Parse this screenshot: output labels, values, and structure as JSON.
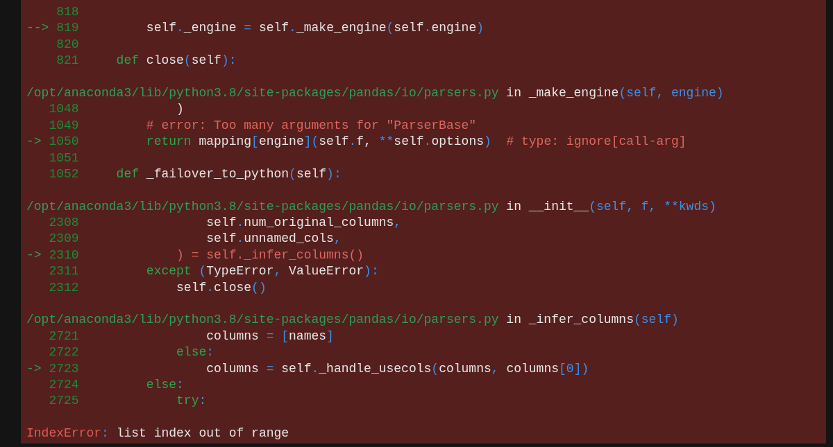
{
  "frames": [
    {
      "lines": [
        {
          "number": "818"
        },
        {
          "number": "819",
          "marker": "-->",
          "tokens": [
            {
              "kind": "text",
              "text": "         self"
            },
            {
              "kind": "punct",
              "text": "."
            },
            {
              "kind": "text",
              "text": "_engine "
            },
            {
              "kind": "punct",
              "text": "="
            },
            {
              "kind": "text",
              "text": " self"
            },
            {
              "kind": "punct",
              "text": "."
            },
            {
              "kind": "text",
              "text": "_make_engine"
            },
            {
              "kind": "punct",
              "text": "("
            },
            {
              "kind": "text",
              "text": "self"
            },
            {
              "kind": "punct",
              "text": "."
            },
            {
              "kind": "text",
              "text": "engine"
            },
            {
              "kind": "punct",
              "text": ")"
            }
          ]
        },
        {
          "number": "820"
        },
        {
          "number": "821",
          "tokens": [
            {
              "kind": "keyword",
              "text": "     def"
            },
            {
              "kind": "text",
              "text": " close"
            },
            {
              "kind": "punct",
              "text": "("
            },
            {
              "kind": "text",
              "text": "self"
            },
            {
              "kind": "punct",
              "text": "):"
            }
          ]
        }
      ]
    },
    {
      "header": {
        "path": "/opt/anaconda3/lib/python3.8/site-packages/pandas/io/parsers.py",
        "word": "in",
        "function": "_make_engine",
        "args": "(self, engine)"
      },
      "lines": [
        {
          "number": "1048",
          "tokens": [
            {
              "kind": "text",
              "text": "             )"
            }
          ]
        },
        {
          "number": "1049",
          "tokens": [
            {
              "kind": "comment",
              "text": "         # error: Too many arguments for \"ParserBase\""
            }
          ]
        },
        {
          "number": "1050",
          "marker": "->",
          "tokens": [
            {
              "kind": "keyword",
              "text": "         return"
            },
            {
              "kind": "text",
              "text": " mapping"
            },
            {
              "kind": "punct",
              "text": "["
            },
            {
              "kind": "text",
              "text": "engine"
            },
            {
              "kind": "punct",
              "text": "]("
            },
            {
              "kind": "text",
              "text": "self"
            },
            {
              "kind": "punct",
              "text": "."
            },
            {
              "kind": "text",
              "text": "f, "
            },
            {
              "kind": "punct",
              "text": "**"
            },
            {
              "kind": "text",
              "text": "self"
            },
            {
              "kind": "punct",
              "text": "."
            },
            {
              "kind": "text",
              "text": "options"
            },
            {
              "kind": "punct",
              "text": ")"
            },
            {
              "kind": "comment",
              "text": "  # type: ignore[call-arg]"
            }
          ]
        },
        {
          "number": "1051"
        },
        {
          "number": "1052",
          "tokens": [
            {
              "kind": "keyword",
              "text": "     def"
            },
            {
              "kind": "text",
              "text": " _failover_to_python"
            },
            {
              "kind": "punct",
              "text": "("
            },
            {
              "kind": "text",
              "text": "self"
            },
            {
              "kind": "punct",
              "text": "):"
            }
          ]
        }
      ]
    },
    {
      "header": {
        "path": "/opt/anaconda3/lib/python3.8/site-packages/pandas/io/parsers.py",
        "word": "in",
        "function": "__init__",
        "args": "(self, f, **kwds)"
      },
      "lines": [
        {
          "number": "2308",
          "tokens": [
            {
              "kind": "text",
              "text": "                 self"
            },
            {
              "kind": "punct",
              "text": "."
            },
            {
              "kind": "text",
              "text": "num_original_columns"
            },
            {
              "kind": "punct",
              "text": ","
            }
          ]
        },
        {
          "number": "2309",
          "tokens": [
            {
              "kind": "text",
              "text": "                 self"
            },
            {
              "kind": "punct",
              "text": "."
            },
            {
              "kind": "text",
              "text": "unnamed_cols"
            },
            {
              "kind": "punct",
              "text": ","
            }
          ]
        },
        {
          "number": "2310",
          "marker": "->",
          "tokens": [
            {
              "kind": "comment",
              "text": "             ) = self._infer_columns()"
            }
          ]
        },
        {
          "number": "2311",
          "tokens": [
            {
              "kind": "keyword",
              "text": "         except "
            },
            {
              "kind": "punct",
              "text": "("
            },
            {
              "kind": "text",
              "text": "TypeError"
            },
            {
              "kind": "punct",
              "text": ","
            },
            {
              "kind": "text",
              "text": " ValueError"
            },
            {
              "kind": "punct",
              "text": "):"
            }
          ]
        },
        {
          "number": "2312",
          "tokens": [
            {
              "kind": "text",
              "text": "             self"
            },
            {
              "kind": "punct",
              "text": "."
            },
            {
              "kind": "text",
              "text": "close"
            },
            {
              "kind": "punct",
              "text": "()"
            }
          ]
        }
      ]
    },
    {
      "header": {
        "path": "/opt/anaconda3/lib/python3.8/site-packages/pandas/io/parsers.py",
        "word": "in",
        "function": "_infer_columns",
        "args": "(self)"
      },
      "lines": [
        {
          "number": "2721",
          "tokens": [
            {
              "kind": "text",
              "text": "                 columns "
            },
            {
              "kind": "punct",
              "text": "= ["
            },
            {
              "kind": "text",
              "text": "names"
            },
            {
              "kind": "punct",
              "text": "]"
            }
          ]
        },
        {
          "number": "2722",
          "tokens": [
            {
              "kind": "keyword",
              "text": "             else"
            },
            {
              "kind": "punct",
              "text": ":"
            }
          ]
        },
        {
          "number": "2723",
          "marker": "->",
          "tokens": [
            {
              "kind": "text",
              "text": "                 columns "
            },
            {
              "kind": "punct",
              "text": "="
            },
            {
              "kind": "text",
              "text": " self"
            },
            {
              "kind": "punct",
              "text": "."
            },
            {
              "kind": "text",
              "text": "_handle_usecols"
            },
            {
              "kind": "punct",
              "text": "("
            },
            {
              "kind": "text",
              "text": "columns"
            },
            {
              "kind": "punct",
              "text": ","
            },
            {
              "kind": "text",
              "text": " columns"
            },
            {
              "kind": "punct",
              "text": "["
            },
            {
              "kind": "number",
              "text": "0"
            },
            {
              "kind": "punct",
              "text": "])"
            }
          ]
        },
        {
          "number": "2724",
          "tokens": [
            {
              "kind": "keyword",
              "text": "         else"
            },
            {
              "kind": "punct",
              "text": ":"
            }
          ]
        },
        {
          "number": "2725",
          "tokens": [
            {
              "kind": "keyword",
              "text": "             try"
            },
            {
              "kind": "punct",
              "text": ":"
            }
          ]
        }
      ]
    }
  ],
  "error": {
    "tokens": [
      {
        "kind": "error",
        "text": "IndexError"
      },
      {
        "kind": "punct",
        "text": ":"
      },
      {
        "kind": "text",
        "text": " list index out of range"
      }
    ]
  }
}
